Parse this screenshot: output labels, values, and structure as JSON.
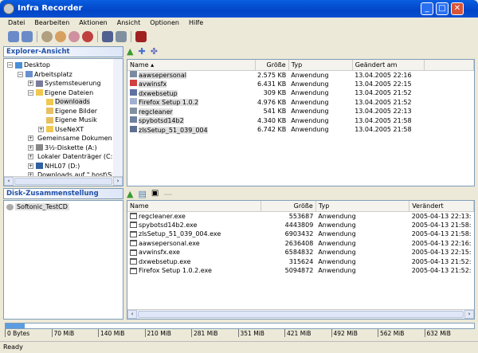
{
  "window": {
    "title": "Infra Recorder",
    "min": "_",
    "max": "□",
    "close": "✕"
  },
  "menu": [
    "Datei",
    "Bearbeiten",
    "Aktionen",
    "Ansicht",
    "Optionen",
    "Hilfe"
  ],
  "explorer": {
    "header": "Explorer-Ansicht",
    "tree": [
      {
        "label": "Desktop",
        "level": 0,
        "exp": "−",
        "color": "#4a8fd8"
      },
      {
        "label": "Arbeitsplatz",
        "level": 1,
        "exp": "−",
        "color": "#6a8fcf"
      },
      {
        "label": "Systemsteuerung",
        "level": 2,
        "exp": "+",
        "color": "#7a7a9a"
      },
      {
        "label": "Eigene Dateien",
        "level": 2,
        "exp": "−",
        "color": "#f0c850"
      },
      {
        "label": "Downloads",
        "level": 3,
        "exp": "",
        "color": "#f0c850",
        "selected": true
      },
      {
        "label": "Eigene Bilder",
        "level": 3,
        "exp": "",
        "color": "#e8c060"
      },
      {
        "label": "Eigene Musik",
        "level": 3,
        "exp": "",
        "color": "#e8c060"
      },
      {
        "label": "UseNeXT",
        "level": 3,
        "exp": "+",
        "color": "#f0c850"
      },
      {
        "label": "Gemeinsame Dokumente",
        "level": 2,
        "exp": "+",
        "color": "#f0c850"
      },
      {
        "label": "3½-Diskette (A:)",
        "level": 2,
        "exp": "+",
        "color": "#888"
      },
      {
        "label": "Lokaler Datenträger (C:)",
        "level": 2,
        "exp": "+",
        "color": "#999"
      },
      {
        "label": "NHL07 (D:)",
        "level": 2,
        "exp": "+",
        "color": "#3060a0"
      },
      {
        "label": "Downloads auf \".host\\Sh",
        "level": 2,
        "exp": "+",
        "color": "#777"
      }
    ],
    "columns": [
      "Name",
      "Größe",
      "Typ",
      "Geändert am"
    ],
    "files": [
      {
        "name": "aawsepersonal",
        "size": "2.575 KB",
        "type": "Anwendung",
        "date": "13.04.2005 22:16",
        "color": "#7a8aa0"
      },
      {
        "name": "avwinsfx",
        "size": "6.431 KB",
        "type": "Anwendung",
        "date": "13.04.2005 22:15",
        "color": "#d04040"
      },
      {
        "name": "dxwebsetup",
        "size": "309 KB",
        "type": "Anwendung",
        "date": "13.04.2005 21:52",
        "color": "#6070a0"
      },
      {
        "name": "Firefox Setup 1.0.2",
        "size": "4.976 KB",
        "type": "Anwendung",
        "date": "13.04.2005 21:52",
        "color": "#a0b0d0"
      },
      {
        "name": "regcleaner",
        "size": "541 KB",
        "type": "Anwendung",
        "date": "13.04.2005 22:13",
        "color": "#8090a0"
      },
      {
        "name": "spybotsd14b2",
        "size": "4.340 KB",
        "type": "Anwendung",
        "date": "13.04.2005 21:58",
        "color": "#7080a0"
      },
      {
        "name": "zlsSetup_51_039_004",
        "size": "6.742 KB",
        "type": "Anwendung",
        "date": "13.04.2005 21:58",
        "color": "#607090"
      }
    ]
  },
  "disk": {
    "header": "Disk-Zusammenstellung",
    "root": "Softonic_TestCD",
    "columns": [
      "Name",
      "Größe",
      "Typ",
      "Verändert"
    ],
    "files": [
      {
        "name": "regcleaner.exe",
        "size": "553687",
        "type": "Anwendung",
        "date": "2005-04-13 22:13:"
      },
      {
        "name": "spybotsd14b2.exe",
        "size": "4443809",
        "type": "Anwendung",
        "date": "2005-04-13 21:58:"
      },
      {
        "name": "zlsSetup_51_039_004.exe",
        "size": "6903432",
        "type": "Anwendung",
        "date": "2005-04-13 21:58:"
      },
      {
        "name": "aawsepersonal.exe",
        "size": "2636408",
        "type": "Anwendung",
        "date": "2005-04-13 22:16:"
      },
      {
        "name": "avwinsfx.exe",
        "size": "6584832",
        "type": "Anwendung",
        "date": "2005-04-13 22:15:"
      },
      {
        "name": "dxwebsetup.exe",
        "size": "315624",
        "type": "Anwendung",
        "date": "2005-04-13 21:52:"
      },
      {
        "name": "Firefox Setup 1.0.2.exe",
        "size": "5094872",
        "type": "Anwendung",
        "date": "2005-04-13 21:52:"
      }
    ]
  },
  "capacity": {
    "fill_fraction": 0.04,
    "ticks": [
      "0 Bytes",
      "70 MiB",
      "140 MiB",
      "210 MiB",
      "281 MiB",
      "351 MiB",
      "421 MiB",
      "492 MiB",
      "562 MiB",
      "632 MiB"
    ]
  },
  "status": "Ready",
  "toolbar_colors": [
    "#6a8ac8",
    "#6a8ac8",
    "#b0a080",
    "#d8a060",
    "#d090a0",
    "#c04040",
    "#506090",
    "#8090a0",
    "#a02020"
  ]
}
